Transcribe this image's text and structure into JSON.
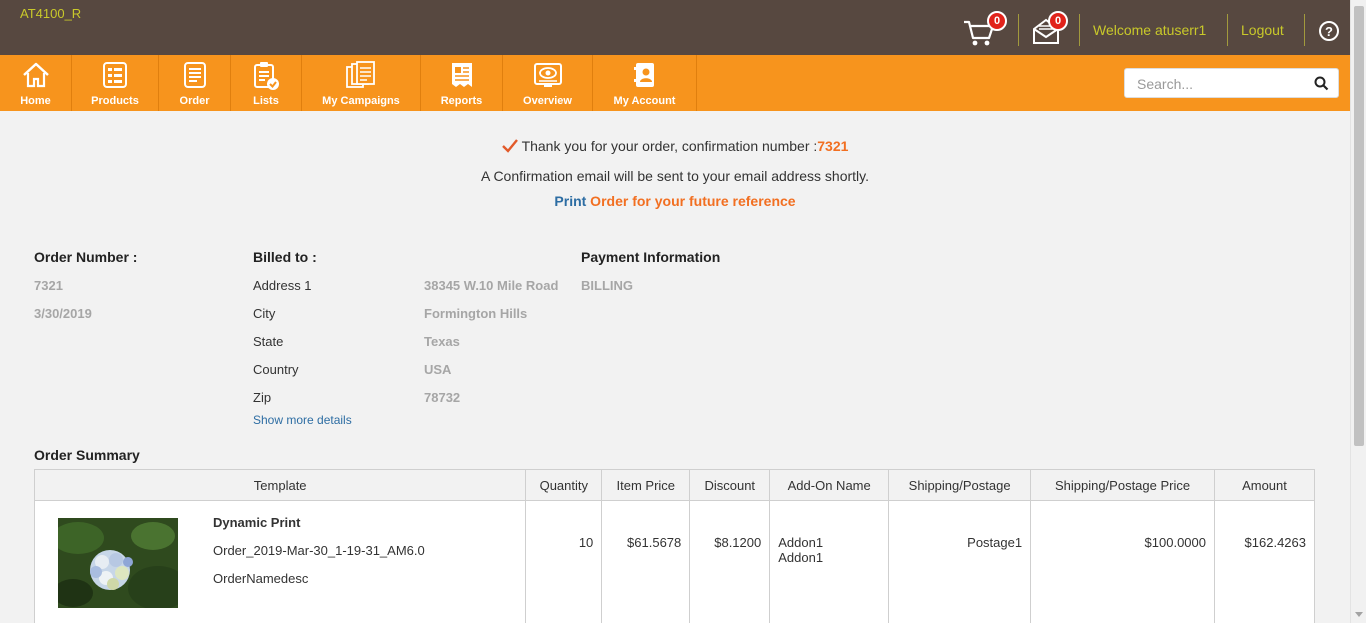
{
  "header": {
    "brand": "AT4100_R",
    "cart_count": "0",
    "mail_count": "0",
    "welcome": "Welcome atuserr1",
    "logout": "Logout",
    "help": "?"
  },
  "nav": {
    "items": [
      {
        "label": "Home",
        "icon": "home-icon"
      },
      {
        "label": "Products",
        "icon": "products-icon"
      },
      {
        "label": "Order",
        "icon": "order-icon"
      },
      {
        "label": "Lists",
        "icon": "lists-icon"
      },
      {
        "label": "My Campaigns",
        "icon": "campaigns-icon"
      },
      {
        "label": "Reports",
        "icon": "reports-icon"
      },
      {
        "label": "Overview",
        "icon": "overview-icon"
      },
      {
        "label": "My Account",
        "icon": "account-icon"
      }
    ],
    "search_placeholder": "Search..."
  },
  "confirmation": {
    "thanks": "Thank you for your order, confirmation number :",
    "number": "7321",
    "email_msg": "A Confirmation email will be sent to your email address shortly.",
    "print_link": "Print",
    "print_rest": " Order for your future reference"
  },
  "order_info": {
    "order_number_label": "Order Number :",
    "order_number": "7321",
    "date": "3/30/2019",
    "billed_to_label": "Billed to :",
    "billing": [
      {
        "label": "Address 1",
        "value": "38345 W.10 Mile Road"
      },
      {
        "label": "City",
        "value": "Formington Hills"
      },
      {
        "label": "State",
        "value": "Texas"
      },
      {
        "label": "Country",
        "value": "USA"
      },
      {
        "label": "Zip",
        "value": "78732"
      }
    ],
    "show_more": "Show more details",
    "payment_label": "Payment Information",
    "payment_value": "BILLING"
  },
  "summary": {
    "title": "Order Summary",
    "columns": [
      "Template",
      "Quantity",
      "Item Price",
      "Discount",
      "Add-On Name",
      "Shipping/Postage",
      "Shipping/Postage Price",
      "Amount"
    ],
    "rows": [
      {
        "name": "Dynamic Print",
        "order_name": "Order_2019-Mar-30_1-19-31_AM6.0",
        "desc": "OrderNamedesc",
        "quantity": "10",
        "item_price": "$61.5678",
        "discount": "$8.1200",
        "addon1": "Addon1",
        "addon2": "Addon1",
        "shipping": "Postage1",
        "shipping_price": "$100.0000",
        "amount": "$162.4263"
      }
    ]
  },
  "colors": {
    "topbar": "#574840",
    "nav": "#f7941d",
    "accent": "#f26f21",
    "link": "#2d6da3"
  }
}
